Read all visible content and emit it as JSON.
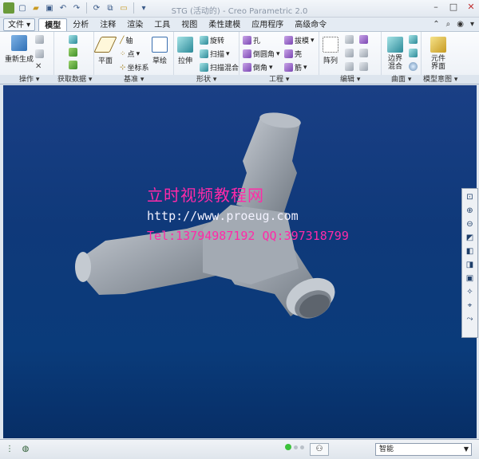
{
  "window": {
    "title": "STG (活动的) - Creo Parametric 2.0",
    "controls": [
      "–",
      "□",
      "✕"
    ]
  },
  "quick_access": [
    "new-icon",
    "open-icon",
    "save-icon",
    "undo-icon",
    "redo-icon",
    "regenerate-icon",
    "windows-icon",
    "close-window-icon",
    "customize-icon"
  ],
  "tabs": {
    "file": "文件",
    "items": [
      "模型",
      "分析",
      "注释",
      "渲染",
      "工具",
      "视图",
      "柔性建模",
      "应用程序",
      "高级命令"
    ],
    "active": "模型"
  },
  "ribbon": {
    "operations": {
      "regenerate": "重新生成",
      "label": "操作"
    },
    "get_data": {
      "label": "获取数据"
    },
    "datum": {
      "plane": "平面",
      "axis": "轴",
      "point": "点",
      "csys": "坐标系",
      "sketch": "草绘",
      "label": "基准"
    },
    "shapes": {
      "extrude": "拉伸",
      "revolve": "旋转",
      "sweep": "扫描",
      "swept_blend": "扫描混合",
      "label": "形状"
    },
    "engineering": {
      "hole": "孔",
      "round": "倒圆角",
      "chamfer": "倒角",
      "draft": "拔模",
      "shell": "壳",
      "rib": "筋",
      "label": "工程"
    },
    "editing": {
      "pattern": "阵列",
      "label": "编辑"
    },
    "surfaces": {
      "boundary_blend": "边界混合",
      "label": "曲面"
    },
    "model_intent": {
      "component_interface": "元件界面",
      "label": "模型意图"
    }
  },
  "watermark": {
    "line1": "立时视频教程网",
    "line2": "http://www.proeug.com",
    "line3": "Tel:13794987192  QQ:397318799"
  },
  "status": {
    "filter": "智能"
  }
}
